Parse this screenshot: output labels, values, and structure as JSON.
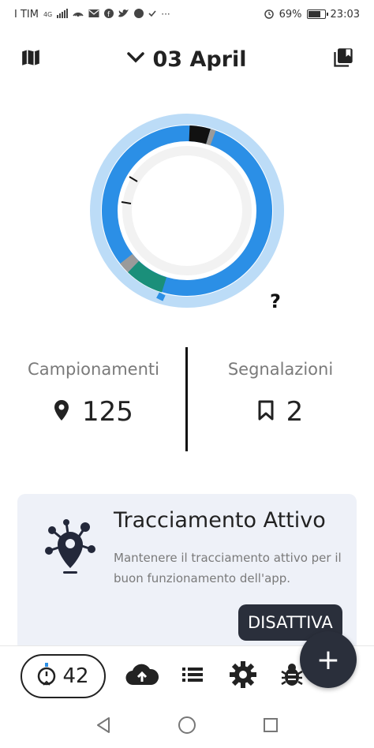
{
  "status_bar": {
    "carrier": "I TIM",
    "network": "4G",
    "battery_text": "69%",
    "battery_level": 0.69,
    "time": "23:03",
    "overflow": "···"
  },
  "header": {
    "date": "03 April",
    "left_icon": "map-icon",
    "right_icon": "library-icon",
    "dropdown_icon": "chevron-down-icon"
  },
  "ring": {
    "help_label": "?",
    "colors": {
      "outer_track": "#bcdcf7",
      "main_blue": "#2b8fe6",
      "teal": "#1a8f7a",
      "gray": "#9a9a9a",
      "dark": "#111111",
      "inner_track": "#f2f2f2"
    }
  },
  "stats": {
    "samplings": {
      "label": "Campionamenti",
      "value": "125",
      "icon": "map-pin-icon"
    },
    "reports": {
      "label": "Segnalazioni",
      "value": "2",
      "icon": "bookmark-icon"
    }
  },
  "card": {
    "title": "Tracciamento Attivo",
    "description": "Mantenere il tracciamento attivo per il buon funzionamento dell'app.",
    "icon": "tracking-pin-icon",
    "button_label": "DISATTIVA"
  },
  "toolbar": {
    "counter_value": "42",
    "counter_icon": "stopwatch-icon",
    "items": [
      "cloud-upload-icon",
      "list-icon",
      "gear-icon",
      "bug-icon"
    ],
    "fab_label": "+"
  },
  "navbar": {
    "items": [
      "back-icon",
      "home-icon",
      "recents-icon"
    ]
  }
}
